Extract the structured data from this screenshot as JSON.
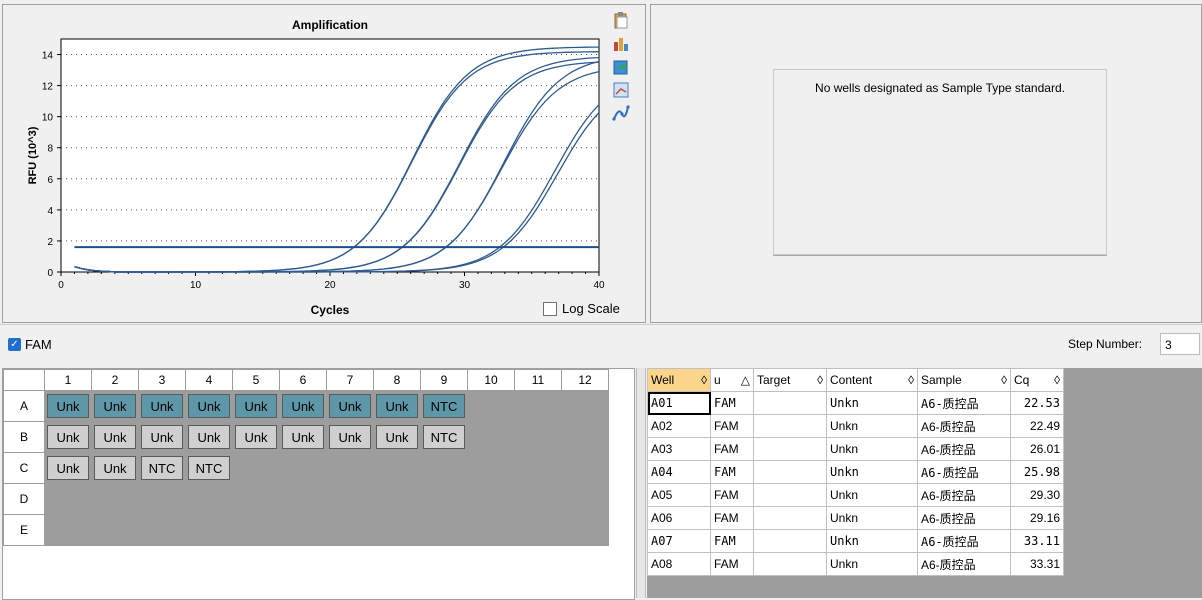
{
  "chart": {
    "title": "Amplification",
    "xlabel": "Cycles",
    "ylabel": "RFU (10^3)",
    "log_scale_label": "Log Scale",
    "x_ticks": [
      "0",
      "10",
      "20",
      "30",
      "40"
    ],
    "y_ticks": [
      "0",
      "2",
      "4",
      "6",
      "8",
      "10",
      "12",
      "14"
    ]
  },
  "chart_data": {
    "type": "line",
    "title": "Amplification",
    "xlabel": "Cycles",
    "ylabel": "RFU (10^3)",
    "xlim": [
      0,
      40
    ],
    "ylim": [
      0,
      15
    ],
    "threshold": 1.6,
    "grid": true,
    "series": [
      {
        "cq": 22.53,
        "plateau": 14.5
      },
      {
        "cq": 22.49,
        "plateau": 14.2
      },
      {
        "cq": 26.01,
        "plateau": 13.9
      },
      {
        "cq": 25.98,
        "plateau": 13.6
      },
      {
        "cq": 29.3,
        "plateau": 14.0
      },
      {
        "cq": 29.16,
        "plateau": 13.3
      },
      {
        "cq": 33.11,
        "plateau": 13.0
      },
      {
        "cq": 33.31,
        "plateau": 12.6
      }
    ]
  },
  "standard_panel": {
    "message": "No wells designated as Sample Type standard."
  },
  "fluor": {
    "label": "FAM",
    "step_label": "Step Number:",
    "step_value": "3"
  },
  "plate": {
    "columns": [
      "1",
      "2",
      "3",
      "4",
      "5",
      "6",
      "7",
      "8",
      "9",
      "10",
      "11",
      "12"
    ],
    "rows": [
      {
        "label": "A",
        "wells": [
          {
            "t": "Unk",
            "s": true
          },
          {
            "t": "Unk",
            "s": true
          },
          {
            "t": "Unk",
            "s": true
          },
          {
            "t": "Unk",
            "s": true
          },
          {
            "t": "Unk",
            "s": true
          },
          {
            "t": "Unk",
            "s": true
          },
          {
            "t": "Unk",
            "s": true
          },
          {
            "t": "Unk",
            "s": true
          },
          {
            "t": "NTC",
            "s": true
          },
          null,
          null,
          null
        ]
      },
      {
        "label": "B",
        "wells": [
          {
            "t": "Unk",
            "s": false
          },
          {
            "t": "Unk",
            "s": false
          },
          {
            "t": "Unk",
            "s": false
          },
          {
            "t": "Unk",
            "s": false
          },
          {
            "t": "Unk",
            "s": false
          },
          {
            "t": "Unk",
            "s": false
          },
          {
            "t": "Unk",
            "s": false
          },
          {
            "t": "Unk",
            "s": false
          },
          {
            "t": "NTC",
            "s": false
          },
          null,
          null,
          null
        ]
      },
      {
        "label": "C",
        "wells": [
          {
            "t": "Unk",
            "s": false
          },
          {
            "t": "Unk",
            "s": false
          },
          {
            "t": "NTC",
            "s": false
          },
          {
            "t": "NTC",
            "s": false
          },
          null,
          null,
          null,
          null,
          null,
          null,
          null,
          null
        ]
      },
      {
        "label": "D",
        "wells": [
          null,
          null,
          null,
          null,
          null,
          null,
          null,
          null,
          null,
          null,
          null,
          null
        ]
      },
      {
        "label": "E",
        "wells": [
          null,
          null,
          null,
          null,
          null,
          null,
          null,
          null,
          null,
          null,
          null,
          null
        ]
      }
    ]
  },
  "results": {
    "headers": [
      "Well",
      "u",
      "Target",
      "Content",
      "Sample",
      "Cq"
    ],
    "rows": [
      [
        "A01",
        "FAM",
        "",
        "Unkn",
        "A6-质控品",
        "22.53"
      ],
      [
        "A02",
        "FAM",
        "",
        "Unkn",
        "A6-质控品",
        "22.49"
      ],
      [
        "A03",
        "FAM",
        "",
        "Unkn",
        "A6-质控品",
        "26.01"
      ],
      [
        "A04",
        "FAM",
        "",
        "Unkn",
        "A6-质控品",
        "25.98"
      ],
      [
        "A05",
        "FAM",
        "",
        "Unkn",
        "A6-质控品",
        "29.30"
      ],
      [
        "A06",
        "FAM",
        "",
        "Unkn",
        "A6-质控品",
        "29.16"
      ],
      [
        "A07",
        "FAM",
        "",
        "Unkn",
        "A6-质控品",
        "33.11"
      ],
      [
        "A08",
        "FAM",
        "",
        "Unkn",
        "A6-质控品",
        "33.31"
      ]
    ]
  }
}
